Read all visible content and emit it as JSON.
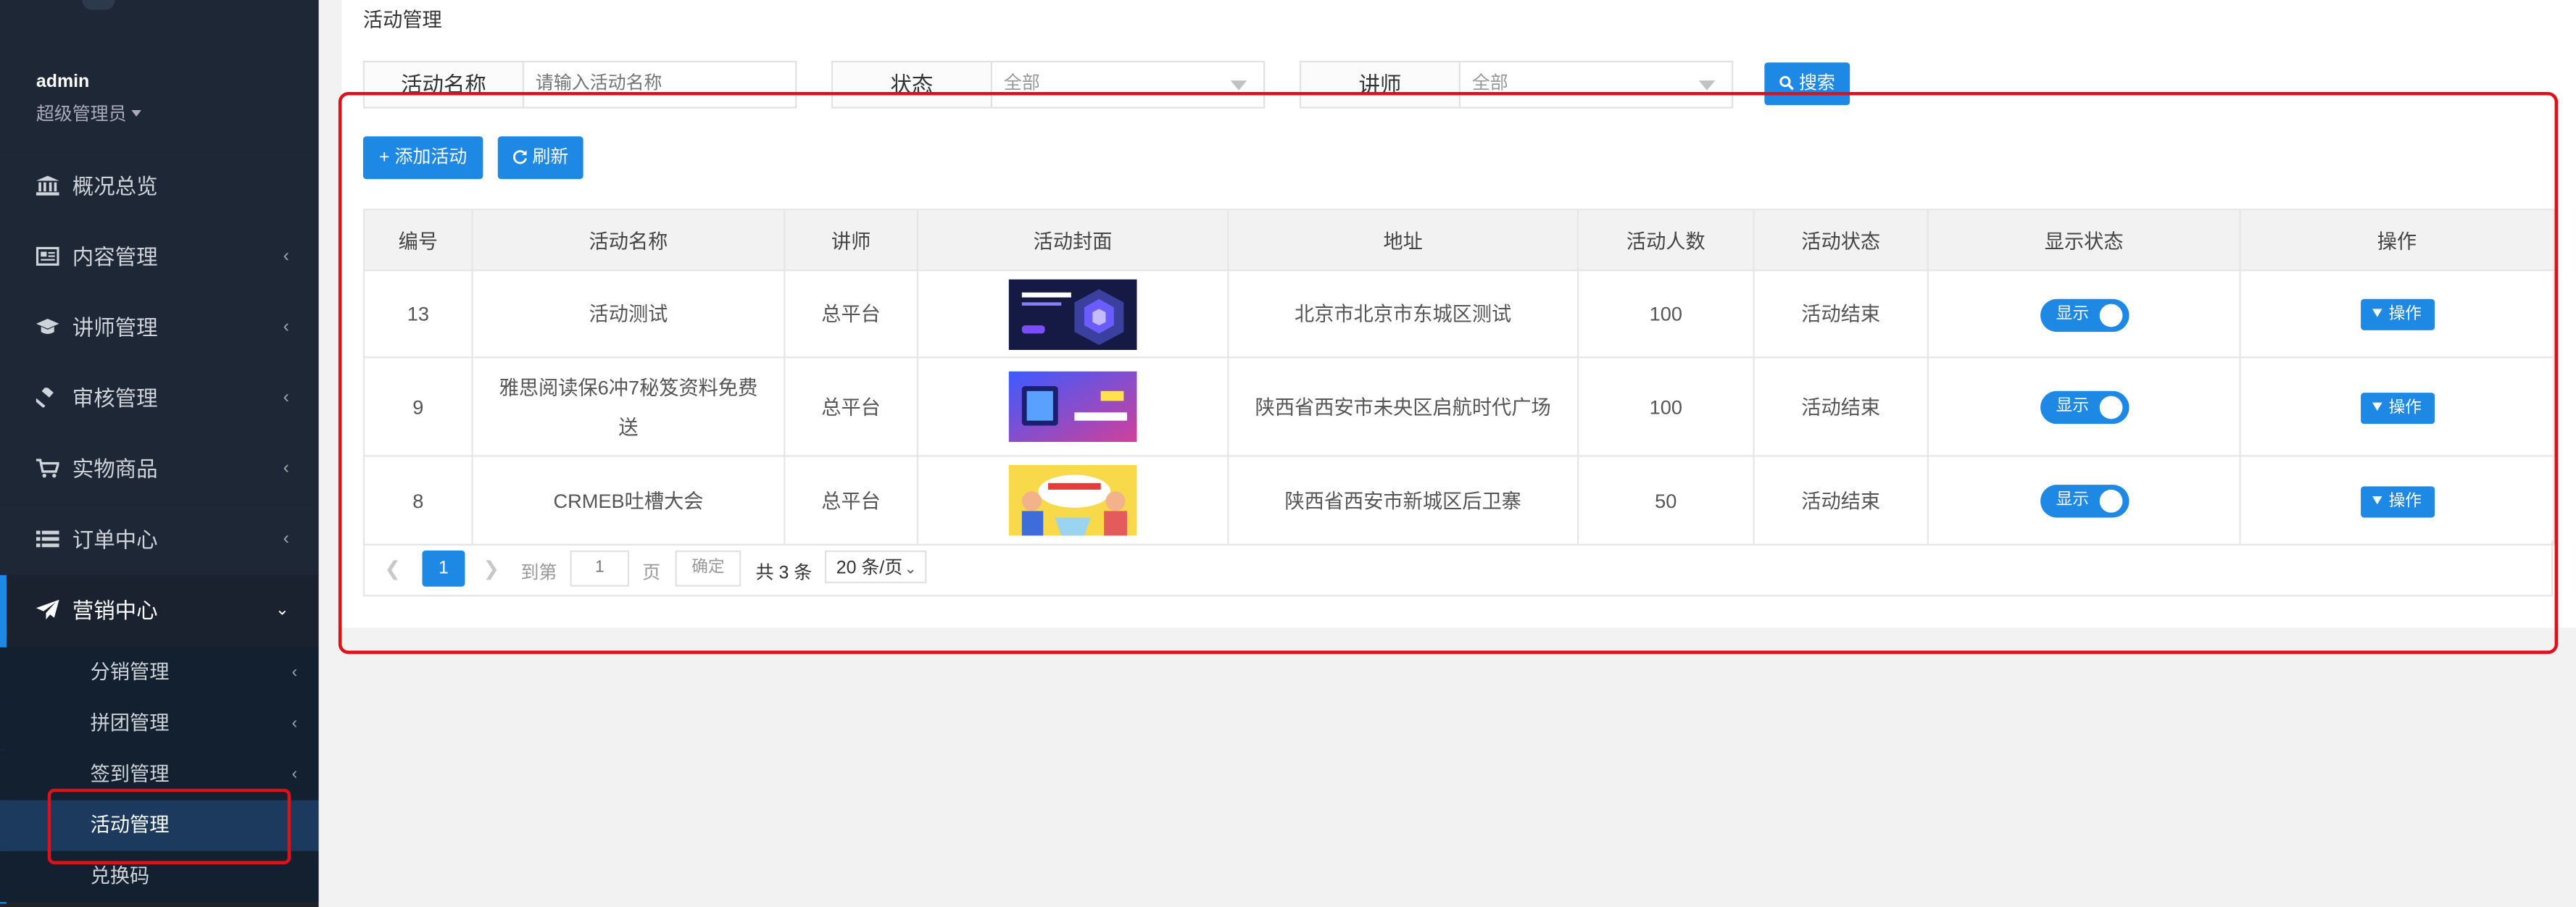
{
  "user": {
    "name": "admin",
    "role": "超级管理员"
  },
  "sidebar": {
    "items": [
      {
        "label": "概况总览",
        "icon": "bank-icon",
        "has_children": false
      },
      {
        "label": "内容管理",
        "icon": "newspaper-icon",
        "has_children": true
      },
      {
        "label": "讲师管理",
        "icon": "graduation-cap-icon",
        "has_children": true
      },
      {
        "label": "审核管理",
        "icon": "gavel-icon",
        "has_children": true
      },
      {
        "label": "实物商品",
        "icon": "cart-icon",
        "has_children": true
      },
      {
        "label": "订单中心",
        "icon": "list-icon",
        "has_children": true
      }
    ],
    "open_group": {
      "label": "营销中心",
      "icon": "paper-plane-icon",
      "children": [
        {
          "label": "分销管理",
          "has_children": true
        },
        {
          "label": "拼团管理",
          "has_children": true
        },
        {
          "label": "签到管理",
          "has_children": true
        },
        {
          "label": "活动管理",
          "has_children": false,
          "active": true
        },
        {
          "label": "兑换码",
          "has_children": false
        }
      ]
    }
  },
  "page": {
    "title": "活动管理"
  },
  "filters": {
    "name_label": "活动名称",
    "name_placeholder": "请输入活动名称",
    "status_label": "状态",
    "status_value": "全部",
    "teacher_label": "讲师",
    "teacher_value": "全部",
    "search_label": "搜索"
  },
  "toolbar": {
    "add_label": "添加活动",
    "refresh_label": "刷新"
  },
  "table": {
    "headers": [
      "编号",
      "活动名称",
      "讲师",
      "活动封面",
      "地址",
      "活动人数",
      "活动状态",
      "显示状态",
      "操作"
    ],
    "rows": [
      {
        "id": "13",
        "name": "活动测试",
        "teacher": "总平台",
        "cover": "cover-banner-dark",
        "address": "北京市北京市东城区测试",
        "count": "100",
        "status": "活动结束",
        "display": "显示",
        "op": "操作"
      },
      {
        "id": "9",
        "name": "雅思阅读保6冲7秘笈资料免费送",
        "teacher": "总平台",
        "cover": "cover-banner-purple",
        "address": "陕西省西安市未央区启航时代广场",
        "count": "100",
        "status": "活动结束",
        "display": "显示",
        "op": "操作"
      },
      {
        "id": "8",
        "name": "CRMEB吐槽大会",
        "teacher": "总平台",
        "cover": "cover-banner-yellow",
        "address": "陕西省西安市新城区后卫寨",
        "count": "50",
        "status": "活动结束",
        "display": "显示",
        "op": "操作"
      }
    ]
  },
  "pagination": {
    "current_page": "1",
    "goto_label": "到第",
    "goto_value": "1",
    "page_unit": "页",
    "confirm_label": "确定",
    "total_text": "共 3 条",
    "page_size": "20 条/页"
  },
  "colors": {
    "accent": "#1e88e5",
    "highlight": "#e0101a",
    "sidebar_bg": "#1d2735"
  }
}
